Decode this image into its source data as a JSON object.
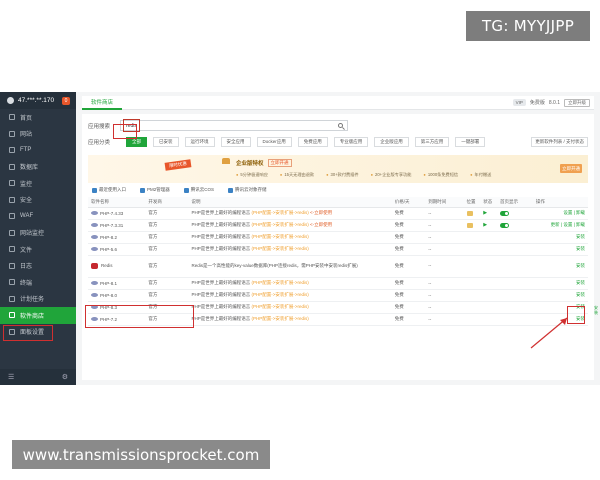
{
  "overlay": {
    "tg_label": "TG: MYYJJPP",
    "url_label": "www.transmissionsprocket.com"
  },
  "sidebar": {
    "server": "47.***.**.170",
    "badge": "0",
    "items": [
      {
        "label": "首页"
      },
      {
        "label": "网站"
      },
      {
        "label": "FTP"
      },
      {
        "label": "数据库"
      },
      {
        "label": "监控"
      },
      {
        "label": "安全"
      },
      {
        "label": "WAF"
      },
      {
        "label": "网站监控"
      },
      {
        "label": "文件"
      },
      {
        "label": "日志"
      },
      {
        "label": "终端"
      },
      {
        "label": "计划任务"
      },
      {
        "label": "软件商店"
      },
      {
        "label": "面板设置"
      }
    ],
    "footer_left": "☰",
    "footer_right": "⚙"
  },
  "topbar": {
    "tab": "软件商店",
    "vip": "VIP",
    "plan": "免费版",
    "version": "8.0.1",
    "update_btn": "立即升级"
  },
  "search": {
    "label": "应用搜索",
    "value": "redis",
    "placeholder": ""
  },
  "categories": {
    "label": "应用分类",
    "items": [
      "全部",
      "已安装",
      "运行环境",
      "安全应用",
      "Docker应用",
      "免费应用",
      "专业版应用",
      "企业版应用",
      "第三方应用",
      "一键部署"
    ],
    "more": "更新软件列表 / 支付状态"
  },
  "promo": {
    "ribbon": "限时优惠",
    "title": "企业版特权",
    "free_tag": "立即开通",
    "features": [
      "5分钟极速响应",
      "15天无理由退款",
      "30+款付费插件",
      "20+企业版专享功能",
      "1000条免费短信",
      "年付赠送"
    ],
    "button": "立即开通"
  },
  "shortcuts": [
    "最近使用入口",
    "PM2管理器",
    "腾讯云COS",
    "腾讯云对象存储"
  ],
  "table": {
    "headers": [
      "软件名称",
      "开发商",
      "说明",
      "",
      "价格/天",
      "到期时间",
      "位置",
      "状态",
      "首页显示",
      "操作"
    ],
    "rows": [
      {
        "name": "PHP-7.4.33",
        "dev": "官方",
        "desc": "PHP是世界上最好的编程语言",
        "note": "(PHP配置->安装扩展->redis)",
        "extra": "<-立即使用",
        "price": "免费",
        "expire": "--",
        "pos": true,
        "status": true,
        "home": true,
        "ops": "设置 | 卸载",
        "logo": "php"
      },
      {
        "name": "PHP-7.3.31",
        "dev": "官方",
        "desc": "PHP是世界上最好的编程语言",
        "note": "(PHP配置->安装扩展->redis)",
        "extra": "<-立即使用",
        "price": "免费",
        "expire": "--",
        "pos": true,
        "status": true,
        "home": true,
        "ops": "更新 | 设置 | 卸载",
        "logo": "php"
      },
      {
        "name": "PHP-8.2",
        "dev": "官方",
        "desc": "PHP是世界上最好的编程语言",
        "note": "(PHP配置->安装扩展->redis)",
        "extra": "",
        "price": "免费",
        "expire": "--",
        "pos": false,
        "status": false,
        "home": false,
        "ops": "安装",
        "logo": "php"
      },
      {
        "name": "PHP-5.6",
        "dev": "官方",
        "desc": "PHP是世界上最好的编程语言",
        "note": "(PHP配置->安装扩展->redis)",
        "extra": "",
        "price": "免费",
        "expire": "--",
        "pos": false,
        "status": false,
        "home": false,
        "ops": "安装",
        "logo": "php"
      },
      {
        "name": "Redis",
        "dev": "官方",
        "desc": "Redis是一个高性能的key-value数据库(PHP连接redis，需PHP安装中安装redis扩展)",
        "note": "",
        "extra": "",
        "price": "免费",
        "expire": "--",
        "pos": false,
        "status": false,
        "home": false,
        "ops": "安装",
        "logo": "redis",
        "tall": true
      },
      {
        "name": "PHP-8.1",
        "dev": "官方",
        "desc": "PHP是世界上最好的编程语言",
        "note": "(PHP配置->安装扩展->redis)",
        "extra": "",
        "price": "免费",
        "expire": "--",
        "pos": false,
        "status": false,
        "home": false,
        "ops": "安装",
        "logo": "php"
      },
      {
        "name": "PHP-8.0",
        "dev": "官方",
        "desc": "PHP是世界上最好的编程语言",
        "note": "(PHP配置->安装扩展->redis)",
        "extra": "",
        "price": "免费",
        "expire": "--",
        "pos": false,
        "status": false,
        "home": false,
        "ops": "安装",
        "logo": "php"
      },
      {
        "name": "PHP-8.3",
        "dev": "官方",
        "desc": "PHP是世界上最好的编程语言",
        "note": "(PHP配置->安装扩展->redis)",
        "extra": "",
        "price": "免费",
        "expire": "--",
        "pos": false,
        "status": false,
        "home": false,
        "ops": "安装",
        "logo": "php"
      },
      {
        "name": "PHP-7.2",
        "dev": "官方",
        "desc": "PHP是世界上最好的编程语言",
        "note": "(PHP配置->安装扩展->redis)",
        "extra": "",
        "price": "免费",
        "expire": "--",
        "pos": false,
        "status": false,
        "home": false,
        "ops": "安装",
        "logo": "php"
      }
    ]
  },
  "edge_text": "安装"
}
